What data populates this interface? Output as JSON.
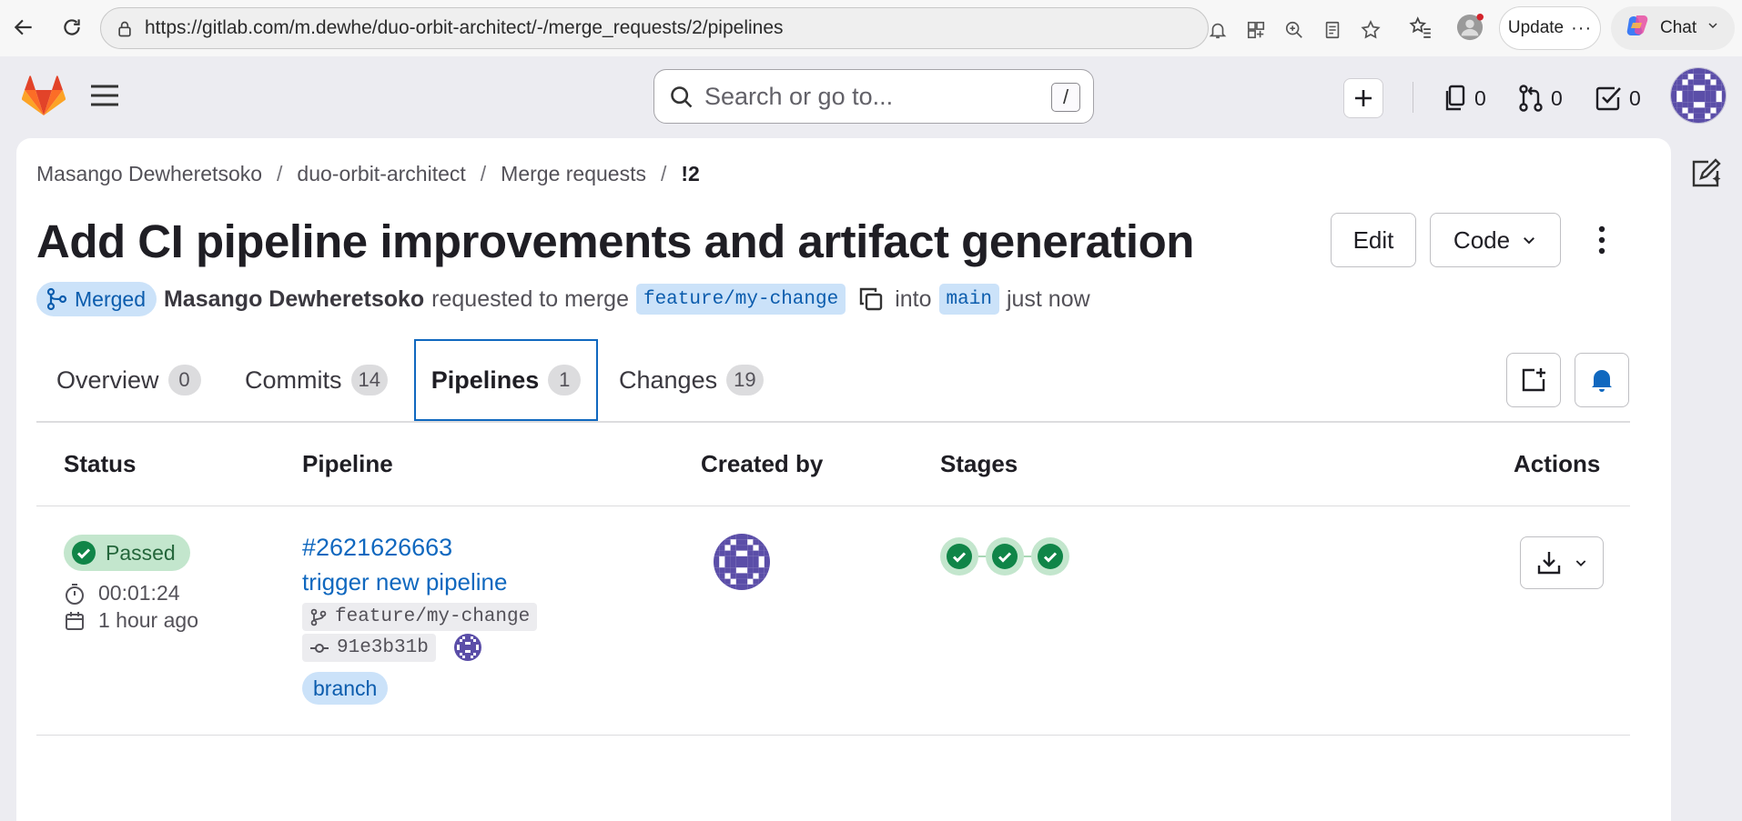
{
  "browser": {
    "url": "https://gitlab.com/m.dewhe/duo-orbit-architect/-/merge_requests/2/pipelines",
    "update_label": "Update",
    "chat_label": "Chat"
  },
  "topbar": {
    "search_placeholder": "Search or go to...",
    "search_shortcut": "/",
    "issues_count": "0",
    "merge_requests_count": "0",
    "todos_count": "0"
  },
  "breadcrumb": {
    "items": [
      "Masango Dewheretsoko",
      "duo-orbit-architect",
      "Merge requests",
      "!2"
    ],
    "separator": "/"
  },
  "mr": {
    "title": "Add CI pipeline improvements and artifact generation",
    "edit_label": "Edit",
    "code_label": "Code",
    "status_label": "Merged",
    "author": "Masango Dewheretsoko",
    "requested_text": "requested to merge",
    "source_branch": "feature/my-change",
    "into_text": "into",
    "target_branch": "main",
    "time_text": "just now"
  },
  "tabs": [
    {
      "label": "Overview",
      "count": "0"
    },
    {
      "label": "Commits",
      "count": "14"
    },
    {
      "label": "Pipelines",
      "count": "1"
    },
    {
      "label": "Changes",
      "count": "19"
    }
  ],
  "table": {
    "headers": {
      "status": "Status",
      "pipeline": "Pipeline",
      "created_by": "Created by",
      "stages": "Stages",
      "actions": "Actions"
    },
    "rows": [
      {
        "status": "Passed",
        "duration": "00:01:24",
        "finished": "1 hour ago",
        "pipeline_id": "#2621626663",
        "pipeline_name": "trigger new pipeline",
        "branch": "feature/my-change",
        "commit_sha": "91e3b31b",
        "ref_type": "branch",
        "stages": [
          "passed",
          "passed",
          "passed"
        ]
      }
    ]
  },
  "colors": {
    "link": "#1068bf",
    "success": "#108548",
    "merged_bg": "#cbe2f9",
    "active_tab_border": "#1068bf"
  }
}
